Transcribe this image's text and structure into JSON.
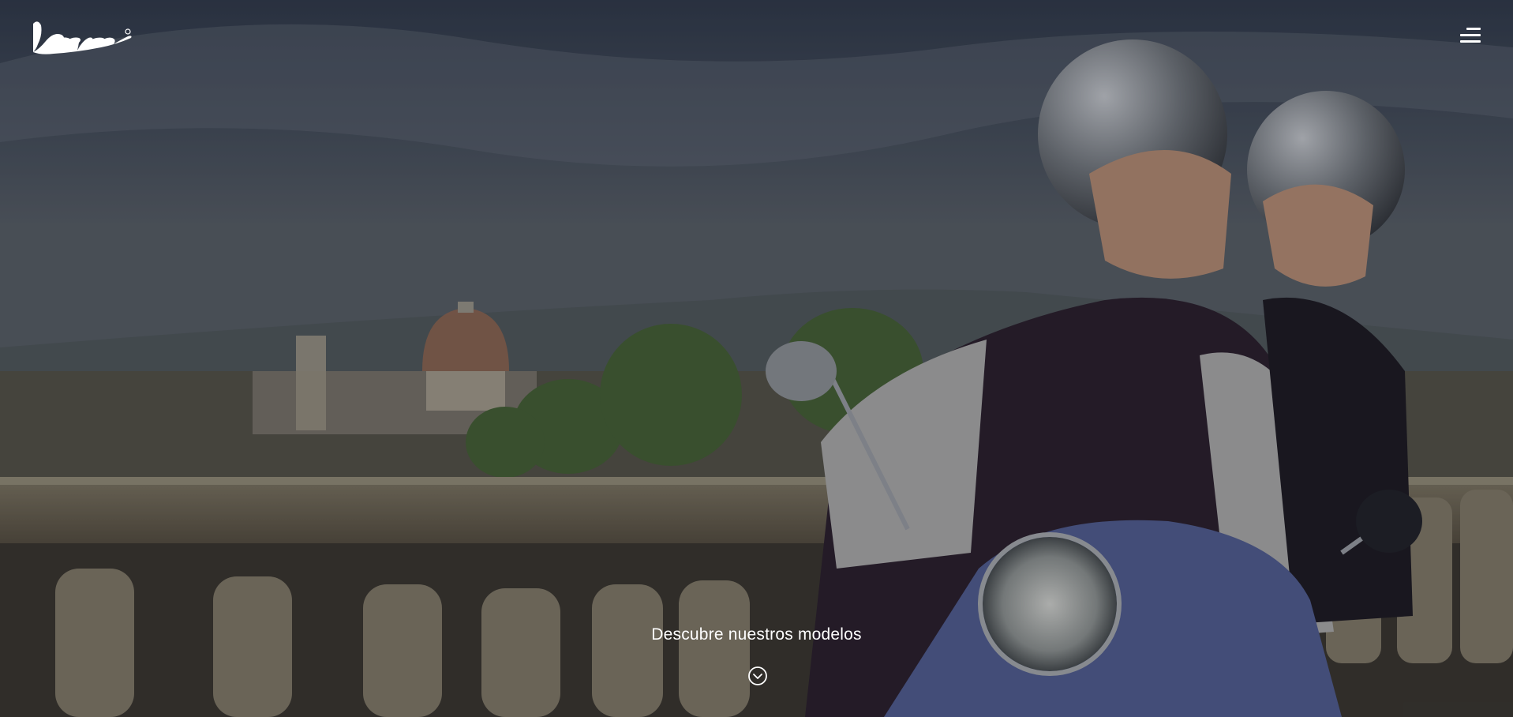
{
  "header": {
    "logo_text": "Vespa",
    "logo_icon": "vespa-logo",
    "menu_icon": "hamburger-menu-icon"
  },
  "hero": {
    "cta_label": "Descubre nuestros modelos",
    "cta_icon": "chevron-down-circle-icon",
    "colors": {
      "text": "#ffffff",
      "overlay": "#0a0c12"
    }
  }
}
